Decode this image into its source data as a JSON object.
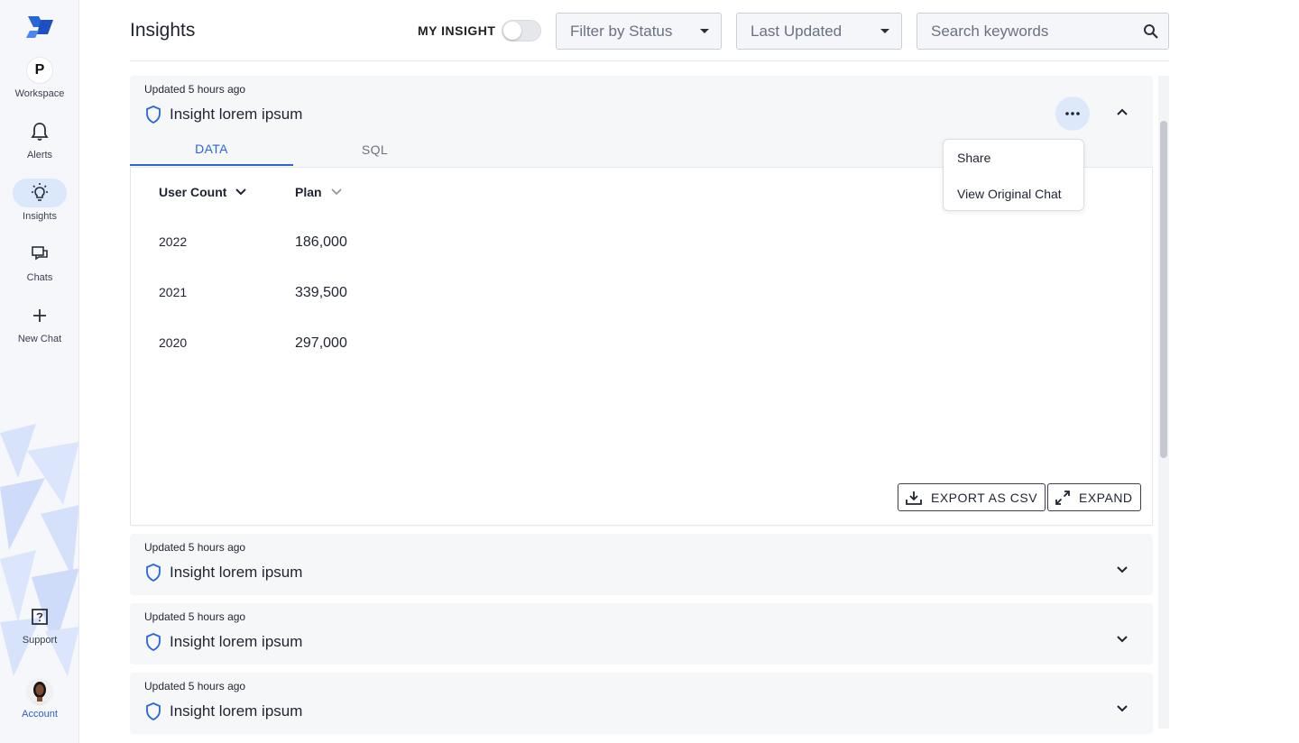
{
  "sidebar": {
    "workspace": {
      "initial": "P",
      "label": "Workspace"
    },
    "items": [
      {
        "label": "Alerts"
      },
      {
        "label": "Insights"
      },
      {
        "label": "Chats"
      },
      {
        "label": "New Chat"
      },
      {
        "label": "Support"
      },
      {
        "label": "Account"
      }
    ]
  },
  "header": {
    "title": "Insights",
    "my_insight_label": "MY INSIGHT",
    "filter_status": "Filter by Status",
    "sort": "Last Updated",
    "search_placeholder": "Search keywords"
  },
  "cards": [
    {
      "updated": "Updated 5 hours ago",
      "title": "Insight lorem ipsum",
      "tabs": [
        "DATA",
        "SQL"
      ],
      "table": {
        "headers": [
          "User Count",
          "Plan"
        ],
        "rows": [
          [
            "2022",
            "186,000"
          ],
          [
            "2021",
            "339,500"
          ],
          [
            "2020",
            "297,000"
          ]
        ]
      },
      "export_label": "EXPORT AS CSV",
      "expand_label": "EXPAND"
    },
    {
      "updated": "Updated 5 hours ago",
      "title": "Insight lorem ipsum"
    },
    {
      "updated": "Updated 5 hours ago",
      "title": "Insight lorem ipsum"
    },
    {
      "updated": "Updated 5 hours ago",
      "title": "Insight lorem ipsum"
    }
  ],
  "menu": {
    "items": [
      "Share",
      "View Original Chat"
    ]
  },
  "colors": {
    "accent": "#2b66d9",
    "active_nav_bg": "#dbe8fb",
    "card_bg": "#f6f7f9"
  },
  "icons": {
    "logo": "brand-logo-icon",
    "alerts": "bell-icon",
    "insights": "lightbulb-icon",
    "chats": "chat-bubbles-icon",
    "new_chat": "plus-icon",
    "support": "question-icon",
    "search": "search-icon",
    "card": "shield-icon",
    "more": "more-horizontal-icon",
    "export": "download-icon",
    "expand": "expand-icon"
  }
}
